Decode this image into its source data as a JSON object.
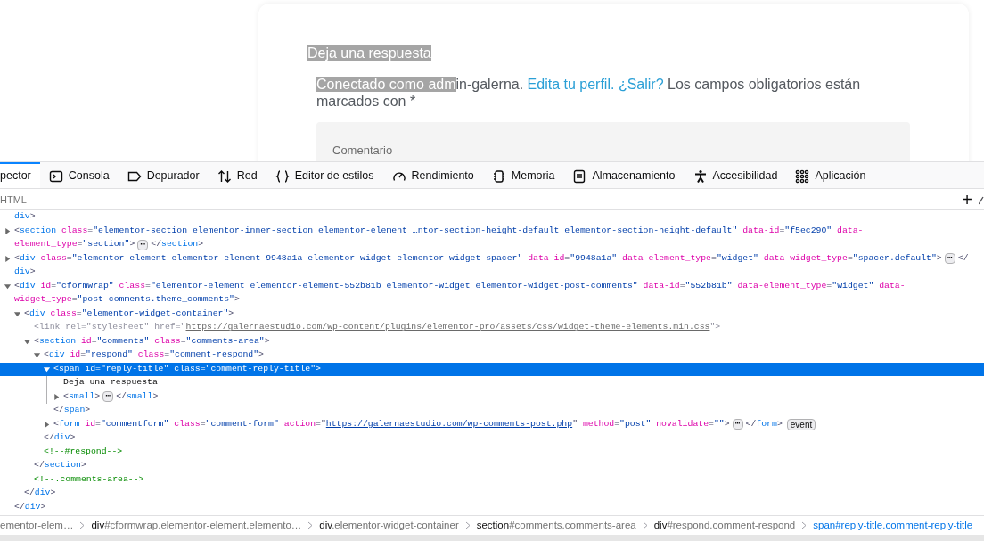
{
  "page": {
    "title": {
      "text": "Deja una respuesta",
      "highlighted": true
    },
    "paragraph": [
      {
        "kind": "text",
        "text": "Conectado como adm",
        "highlighted": true
      },
      {
        "kind": "text",
        "text": "in-galerna. ",
        "highlighted": false
      },
      {
        "kind": "link",
        "text": "Edita tu perfil.",
        "highlighted": false
      },
      {
        "kind": "link",
        "text": "¿Salir?",
        "highlighted": false
      },
      {
        "kind": "text",
        "text": " Los campos obligatorios están marcados con *",
        "highlighted": false
      }
    ],
    "comment_field": {
      "placeholder": "Comentario"
    }
  },
  "devtools": {
    "tabs": [
      {
        "label": "pector",
        "selected": true
      },
      {
        "label": "Consola",
        "selected": false
      },
      {
        "label": "Depurador",
        "selected": false
      },
      {
        "label": "Red",
        "selected": false
      },
      {
        "label": "Editor de estilos",
        "selected": false
      },
      {
        "label": "Rendimiento",
        "selected": false
      },
      {
        "label": "Memoria",
        "selected": false
      },
      {
        "label": "Almacenamiento",
        "selected": false
      },
      {
        "label": "Accesibilidad",
        "selected": false
      },
      {
        "label": "Aplicación",
        "selected": false
      }
    ],
    "search": {
      "placeholder": "HTML"
    },
    "add_button": "+",
    "nodes": [
      {
        "selected": false,
        "lines": [
          [
            {
              "kind": "tag",
              "text": "div"
            },
            {
              "kind": "p",
              "text": ">"
            }
          ]
        ]
      },
      {
        "selected": false,
        "expanded": false,
        "lines": [
          [
            {
              "kind": "p",
              "text": "<"
            },
            {
              "kind": "tag",
              "text": "section"
            },
            {
              "kind": "attr",
              "text": " class"
            },
            {
              "kind": "p",
              "text": "="
            },
            {
              "kind": "val",
              "text": "\"elementor-section elementor-inner-section elementor-element …ntor-section-height-default elementor-section-height-default\""
            },
            {
              "kind": "attr",
              "text": " data-id"
            },
            {
              "kind": "p",
              "text": "="
            },
            {
              "kind": "val",
              "text": "\"f5ec290\""
            },
            {
              "kind": "attr",
              "text": " data-"
            }
          ],
          [
            {
              "kind": "attr",
              "text": "element_type"
            },
            {
              "kind": "p",
              "text": "="
            },
            {
              "kind": "val",
              "text": "\"section\""
            },
            {
              "kind": "p",
              "text": ">"
            },
            {
              "kind": "more",
              "text": "⋯"
            },
            {
              "kind": "p",
              "text": "</"
            },
            {
              "kind": "tag",
              "text": "section"
            },
            {
              "kind": "p",
              "text": ">"
            }
          ]
        ]
      },
      {
        "selected": false,
        "expanded": false,
        "lines": [
          [
            {
              "kind": "p",
              "text": "<"
            },
            {
              "kind": "tag",
              "text": "div"
            },
            {
              "kind": "attr",
              "text": " class"
            },
            {
              "kind": "p",
              "text": "="
            },
            {
              "kind": "val",
              "text": "\"elementor-element elementor-element-9948a1a elementor-widget elementor-widget-spacer\""
            },
            {
              "kind": "attr",
              "text": " data-id"
            },
            {
              "kind": "p",
              "text": "="
            },
            {
              "kind": "val",
              "text": "\"9948a1a\""
            },
            {
              "kind": "attr",
              "text": " data-element_type"
            },
            {
              "kind": "p",
              "text": "="
            },
            {
              "kind": "val",
              "text": "\"widget\""
            },
            {
              "kind": "attr",
              "text": " data-widget_type"
            },
            {
              "kind": "p",
              "text": "="
            },
            {
              "kind": "val",
              "text": "\"spacer.default\""
            },
            {
              "kind": "p",
              "text": ">"
            },
            {
              "kind": "more",
              "text": "⋯"
            },
            {
              "kind": "p",
              "text": "</"
            }
          ],
          [
            {
              "kind": "tag",
              "text": "div"
            },
            {
              "kind": "p",
              "text": ">"
            }
          ]
        ]
      },
      {
        "selected": false,
        "expanded": true,
        "lines": [
          [
            {
              "kind": "p",
              "text": "<"
            },
            {
              "kind": "tag",
              "text": "div"
            },
            {
              "kind": "attr",
              "text": " id"
            },
            {
              "kind": "p",
              "text": "="
            },
            {
              "kind": "val",
              "text": "\"cformwrap\""
            },
            {
              "kind": "attr",
              "text": " class"
            },
            {
              "kind": "p",
              "text": "="
            },
            {
              "kind": "val",
              "text": "\"elementor-element elementor-element-552b81b elementor-widget elementor-widget-post-comments\""
            },
            {
              "kind": "attr",
              "text": " data-id"
            },
            {
              "kind": "p",
              "text": "="
            },
            {
              "kind": "val",
              "text": "\"552b81b\""
            },
            {
              "kind": "attr",
              "text": " data-element_type"
            },
            {
              "kind": "p",
              "text": "="
            },
            {
              "kind": "val",
              "text": "\"widget\""
            },
            {
              "kind": "attr",
              "text": " data-"
            }
          ],
          [
            {
              "kind": "attr",
              "text": "widget_type"
            },
            {
              "kind": "p",
              "text": "="
            },
            {
              "kind": "val",
              "text": "\"post-comments.theme_comments\""
            },
            {
              "kind": "p",
              "text": ">"
            }
          ]
        ],
        "close": [
          {
            "kind": "p",
            "text": "</"
          },
          {
            "kind": "tag",
            "text": "div"
          },
          {
            "kind": "p",
            "text": ">"
          }
        ],
        "children": [
          {
            "selected": false,
            "expanded": true,
            "lines": [
              [
                {
                  "kind": "p",
                  "text": "<"
                },
                {
                  "kind": "tag",
                  "text": "div"
                },
                {
                  "kind": "attr",
                  "text": " class"
                },
                {
                  "kind": "p",
                  "text": "="
                },
                {
                  "kind": "val",
                  "text": "\"elementor-widget-container\""
                },
                {
                  "kind": "p",
                  "text": ">"
                }
              ]
            ],
            "close": [
              {
                "kind": "p",
                "text": "</"
              },
              {
                "kind": "tag",
                "text": "div"
              },
              {
                "kind": "p",
                "text": ">"
              }
            ],
            "children": [
              {
                "selected": false,
                "lines": [
                  [
                    {
                      "kind": "dim",
                      "text": "<link rel=\"stylesheet\" href=\""
                    },
                    {
                      "kind": "dimlink",
                      "text": "https://galernaestudio.com/wp-content/plugins/elementor-pro/assets/css/widget-theme-elements.min.css"
                    },
                    {
                      "kind": "dim",
                      "text": "\">"
                    }
                  ]
                ]
              },
              {
                "selected": false,
                "expanded": true,
                "lines": [
                  [
                    {
                      "kind": "p",
                      "text": "<"
                    },
                    {
                      "kind": "tag",
                      "text": "section"
                    },
                    {
                      "kind": "attr",
                      "text": " id"
                    },
                    {
                      "kind": "p",
                      "text": "="
                    },
                    {
                      "kind": "val",
                      "text": "\"comments\""
                    },
                    {
                      "kind": "attr",
                      "text": " class"
                    },
                    {
                      "kind": "p",
                      "text": "="
                    },
                    {
                      "kind": "val",
                      "text": "\"comments-area\""
                    },
                    {
                      "kind": "p",
                      "text": ">"
                    }
                  ]
                ],
                "close": [
                  {
                    "kind": "p",
                    "text": "</"
                  },
                  {
                    "kind": "tag",
                    "text": "section"
                  },
                  {
                    "kind": "p",
                    "text": ">"
                  }
                ],
                "children": [
                  {
                    "selected": false,
                    "expanded": true,
                    "lines": [
                      [
                        {
                          "kind": "p",
                          "text": "<"
                        },
                        {
                          "kind": "tag",
                          "text": "div"
                        },
                        {
                          "kind": "attr",
                          "text": " id"
                        },
                        {
                          "kind": "p",
                          "text": "="
                        },
                        {
                          "kind": "val",
                          "text": "\"respond\""
                        },
                        {
                          "kind": "attr",
                          "text": " class"
                        },
                        {
                          "kind": "p",
                          "text": "="
                        },
                        {
                          "kind": "val",
                          "text": "\"comment-respond\""
                        },
                        {
                          "kind": "p",
                          "text": ">"
                        }
                      ]
                    ],
                    "close": [
                      {
                        "kind": "p",
                        "text": "</"
                      },
                      {
                        "kind": "tag",
                        "text": "div"
                      },
                      {
                        "kind": "p",
                        "text": ">"
                      }
                    ],
                    "children": [
                      {
                        "selected": true,
                        "expanded": true,
                        "lines": [
                          [
                            {
                              "kind": "p",
                              "text": "<"
                            },
                            {
                              "kind": "tag",
                              "text": "span"
                            },
                            {
                              "kind": "attr",
                              "text": " id"
                            },
                            {
                              "kind": "p",
                              "text": "="
                            },
                            {
                              "kind": "val",
                              "text": "\"reply-title\""
                            },
                            {
                              "kind": "attr",
                              "text": " class"
                            },
                            {
                              "kind": "p",
                              "text": "="
                            },
                            {
                              "kind": "val",
                              "text": "\"comment-reply-title\""
                            },
                            {
                              "kind": "p",
                              "text": ">"
                            }
                          ]
                        ],
                        "close": [
                          {
                            "kind": "p",
                            "text": "</"
                          },
                          {
                            "kind": "tag",
                            "text": "span"
                          },
                          {
                            "kind": "p",
                            "text": ">"
                          }
                        ],
                        "children": [
                          {
                            "selected": false,
                            "lines": [
                              [
                                {
                                  "kind": "text",
                                  "text": "Deja una respuesta"
                                }
                              ]
                            ]
                          },
                          {
                            "selected": false,
                            "expanded": false,
                            "lines": [
                              [
                                {
                                  "kind": "p",
                                  "text": "<"
                                },
                                {
                                  "kind": "tag",
                                  "text": "small"
                                },
                                {
                                  "kind": "p",
                                  "text": ">"
                                },
                                {
                                  "kind": "more",
                                  "text": "⋯"
                                },
                                {
                                  "kind": "p",
                                  "text": "</"
                                },
                                {
                                  "kind": "tag",
                                  "text": "small"
                                },
                                {
                                  "kind": "p",
                                  "text": ">"
                                }
                              ]
                            ]
                          }
                        ]
                      },
                      {
                        "selected": false,
                        "expanded": false,
                        "lines": [
                          [
                            {
                              "kind": "p",
                              "text": "<"
                            },
                            {
                              "kind": "tag",
                              "text": "form"
                            },
                            {
                              "kind": "attr",
                              "text": " id"
                            },
                            {
                              "kind": "p",
                              "text": "="
                            },
                            {
                              "kind": "val",
                              "text": "\"commentform\""
                            },
                            {
                              "kind": "attr",
                              "text": " class"
                            },
                            {
                              "kind": "p",
                              "text": "="
                            },
                            {
                              "kind": "val",
                              "text": "\"comment-form\""
                            },
                            {
                              "kind": "attr",
                              "text": " action"
                            },
                            {
                              "kind": "p",
                              "text": "=\""
                            },
                            {
                              "kind": "link",
                              "text": "https://galernaestudio.com/wp-comments-post.php"
                            },
                            {
                              "kind": "p",
                              "text": "\""
                            },
                            {
                              "kind": "attr",
                              "text": " method"
                            },
                            {
                              "kind": "p",
                              "text": "="
                            },
                            {
                              "kind": "val",
                              "text": "\"post\""
                            },
                            {
                              "kind": "attr",
                              "text": " novalidate"
                            },
                            {
                              "kind": "p",
                              "text": "="
                            },
                            {
                              "kind": "val",
                              "text": "\"\""
                            },
                            {
                              "kind": "p",
                              "text": ">"
                            },
                            {
                              "kind": "more",
                              "text": "⋯"
                            },
                            {
                              "kind": "p",
                              "text": "</"
                            },
                            {
                              "kind": "tag",
                              "text": "form"
                            },
                            {
                              "kind": "p",
                              "text": ">"
                            },
                            {
                              "kind": "badge",
                              "text": "event"
                            }
                          ]
                        ]
                      }
                    ]
                  },
                  {
                    "selected": false,
                    "lines": [
                      [
                        {
                          "kind": "comment",
                          "text": "<!--#respond-->"
                        }
                      ]
                    ]
                  }
                ]
              },
              {
                "selected": false,
                "lines": [
                  [
                    {
                      "kind": "comment",
                      "text": "<!--.comments-area-->"
                    }
                  ]
                ]
              }
            ]
          }
        ]
      }
    ],
    "breadcrumbs": [
      {
        "rest": "ementor-elem…",
        "selected": false
      },
      {
        "tag": "div",
        "rest": "#cformwrap.elementor-element.elemento…",
        "selected": false
      },
      {
        "tag": "div",
        "rest": ".elementor-widget-container",
        "selected": false
      },
      {
        "tag": "section",
        "rest": "#comments.comments-area",
        "selected": false
      },
      {
        "tag": "div",
        "rest": "#respond.comment-respond",
        "selected": false
      },
      {
        "tag": "span",
        "rest": "#reply-title.comment-reply-title",
        "selected": true
      }
    ]
  }
}
